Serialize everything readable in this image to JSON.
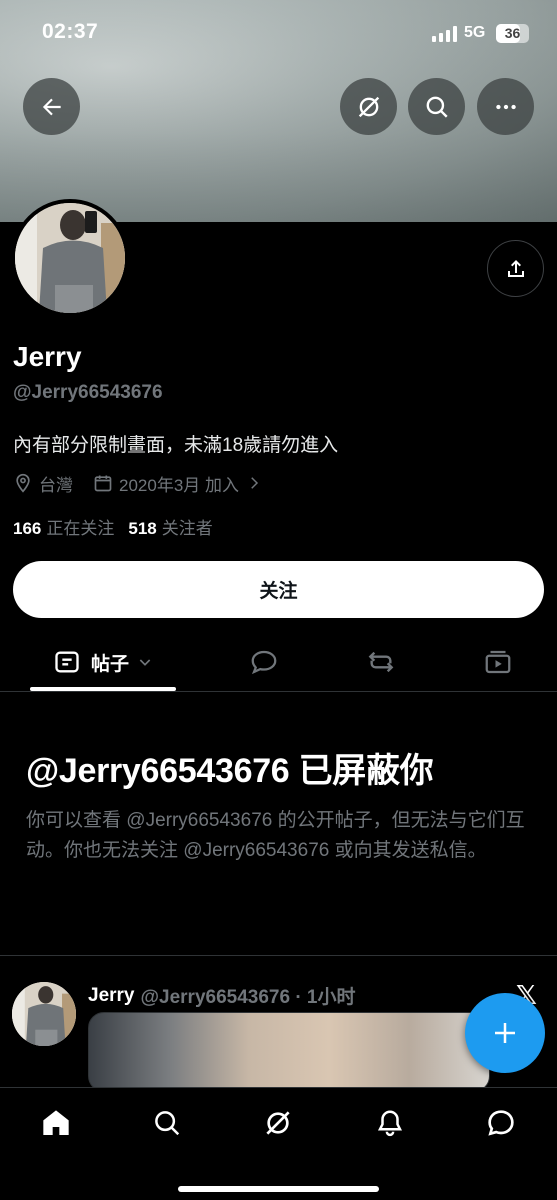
{
  "status_bar": {
    "time": "02:37",
    "network": "5G",
    "battery": "36"
  },
  "profile": {
    "name": "Jerry",
    "handle": "@Jerry66543676",
    "bio": "內有部分限制畫面，未滿18歲請勿進入",
    "location": "台灣",
    "joined": "2020年3月 加入",
    "following_count": "166",
    "following_label": "正在关注",
    "followers_count": "518",
    "followers_label": "关注者"
  },
  "follow_button_label": "关注",
  "tabs": {
    "active_label": "帖子"
  },
  "blocked": {
    "title": "@Jerry66543676 已屏蔽你",
    "body": "你可以查看 @Jerry66543676 的公开帖子，但无法与它们互动。你也无法关注 @Jerry66543676 或向其发送私信。"
  },
  "post": {
    "name": "Jerry",
    "handle_time": "@Jerry66543676 · 1小时"
  },
  "icons": {
    "back": "arrow-left-icon",
    "grok": "grok-icon",
    "search": "search-icon",
    "more": "more-icon",
    "share": "share-icon",
    "location": "location-pin-icon",
    "calendar": "calendar-icon",
    "posts_tab": "posts-icon",
    "replies_tab": "reply-icon",
    "reposts_tab": "repost-icon",
    "media_tab": "media-icon",
    "compose": "plus-icon",
    "x_logo": "x-logo-icon",
    "nav": [
      "home-icon",
      "search-icon",
      "grok-icon",
      "bell-icon",
      "messages-icon"
    ]
  },
  "colors": {
    "accent": "#1d9bf0",
    "background": "#000000",
    "muted_text": "#71767b"
  }
}
